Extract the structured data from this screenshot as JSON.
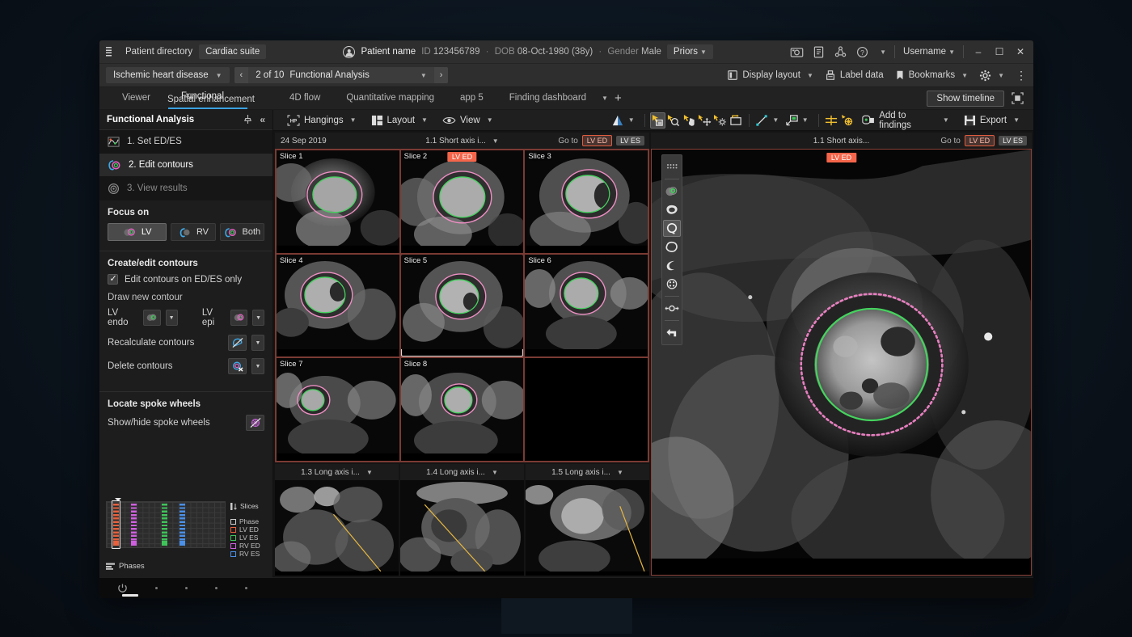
{
  "header": {
    "patient_directory": "Patient directory",
    "cardiac_suite": "Cardiac suite",
    "patient_name": "Patient name",
    "id_label": "ID",
    "id_value": "123456789",
    "dob_label": "DOB",
    "dob_value": "08-Oct-1980 (38y)",
    "gender_label": "Gender",
    "gender_value": "Male",
    "priors": "Priors",
    "username": "Username",
    "icons": [
      "camera-icon",
      "report-icon",
      "share-icon",
      "help-icon"
    ],
    "window_controls": [
      "minimize",
      "maximize",
      "close"
    ]
  },
  "bar2": {
    "disease": "Ischemic heart disease",
    "prev": "‹",
    "next": "›",
    "counter": "2 of 10",
    "study": "Functional Analysis",
    "display_layout": "Display layout",
    "label_data": "Label data",
    "bookmarks": "Bookmarks"
  },
  "tabs": {
    "items": [
      {
        "label": "Viewer",
        "active": false
      },
      {
        "label": "4D flow",
        "active": false
      },
      {
        "label": "Quantitative mapping",
        "active": false
      },
      {
        "label": "app 5",
        "active": false
      },
      {
        "label": "Finding dashboard",
        "active": false
      }
    ],
    "overlap_front": "Functional",
    "overlap_front_close": "×",
    "overlap_back": "Spatial enhancement",
    "add": "+",
    "show_timeline": "Show timeline"
  },
  "sidebar": {
    "title": "Functional Analysis",
    "steps": [
      {
        "label": "1. Set ED/ES",
        "state": "normal",
        "icon": "ed-es-curve-icon"
      },
      {
        "label": "2. Edit contours",
        "state": "active",
        "icon": "contours-icon"
      },
      {
        "label": "3. View results",
        "state": "disabled",
        "icon": "results-icon"
      }
    ],
    "focus_on_label": "Focus on",
    "focus_options": [
      {
        "label": "LV",
        "selected": true
      },
      {
        "label": "RV",
        "selected": false
      },
      {
        "label": "Both",
        "selected": false
      }
    ],
    "create_edit_label": "Create/edit contours",
    "edit_only_label": "Edit contours on ED/ES only",
    "edit_only_checked": true,
    "draw_new_label": "Draw new contour",
    "lv_endo_label": "LV endo",
    "lv_epi_label": "LV epi",
    "recalculate_label": "Recalculate contours",
    "delete_label": "Delete contours",
    "locate_label": "Locate spoke wheels",
    "show_hide_label": "Show/hide spoke wheels"
  },
  "phases_widget": {
    "slices_label": "Slices",
    "phases_label": "Phases",
    "legend": [
      {
        "label": "Phase",
        "color": "#d0d0d0"
      },
      {
        "label": "LV ED",
        "color": "#e8603c"
      },
      {
        "label": "LV ES",
        "color": "#3fc45a"
      },
      {
        "label": "RV ED",
        "color": "#d05fe0"
      },
      {
        "label": "RV ES",
        "color": "#4a8fe8"
      }
    ],
    "columns": [
      {
        "color": "#e8603c",
        "x": 8,
        "selected": true
      },
      {
        "color": "#d05fe0",
        "x": 30,
        "selected": false
      },
      {
        "color": "#3fc45a",
        "x": 68,
        "selected": false
      },
      {
        "color": "#4a8fe8",
        "x": 90,
        "selected": false
      }
    ]
  },
  "toolbar": {
    "hangings": "Hangings",
    "layout": "Layout",
    "view": "View",
    "add_to_findings": "Add to findings",
    "export": "Export",
    "tools": [
      {
        "name": "window-level-icon",
        "active": false
      },
      {
        "name": "pan-select-icon",
        "active": true
      },
      {
        "name": "zoom-icon",
        "active": false
      },
      {
        "name": "pan-hand-icon",
        "active": false
      },
      {
        "name": "move-icon",
        "active": false
      },
      {
        "name": "contrast-icon",
        "active": false
      },
      {
        "name": "reset-icon",
        "active": false
      },
      {
        "name": "measure-line-icon",
        "active": false
      },
      {
        "name": "annotate-icon",
        "active": false
      },
      {
        "name": "crosshair-icon",
        "active": false
      },
      {
        "name": "spoke-wheel-icon",
        "active": false
      }
    ]
  },
  "left_pane": {
    "date": "24 Sep 2019",
    "title": "1.1 Short axis i...",
    "goto": "Go to",
    "badge_ed": "LV ED",
    "badge_es": "LV ES",
    "slices": [
      {
        "label": "Slice 1",
        "badge": null,
        "selected": false
      },
      {
        "label": "Slice 2",
        "badge": "LV ED",
        "selected": false
      },
      {
        "label": "Slice 3",
        "badge": null,
        "selected": false
      },
      {
        "label": "Slice 4",
        "badge": null,
        "selected": false
      },
      {
        "label": "Slice 5",
        "badge": null,
        "selected": true
      },
      {
        "label": "Slice 6",
        "badge": null,
        "selected": false
      },
      {
        "label": "Slice 7",
        "badge": null,
        "selected": false
      },
      {
        "label": "Slice 8",
        "badge": null,
        "selected": false
      },
      {
        "label": "",
        "badge": null,
        "selected": false
      }
    ],
    "long_axis": [
      {
        "title": "1.3 Long axis i..."
      },
      {
        "title": "1.4 Long axis i..."
      },
      {
        "title": "1.5 Long axis i..."
      }
    ]
  },
  "right_pane": {
    "title": "1.1 Short axis...",
    "goto": "Go to",
    "badge_ed": "LV ED",
    "badge_es": "LV ES",
    "overlay_badge": "LV ED",
    "palette_tools": [
      {
        "name": "grip-handle-icon",
        "active": false
      },
      {
        "name": "endo-contour-icon",
        "active": false
      },
      {
        "name": "freehand-contour-icon",
        "active": false
      },
      {
        "name": "circle-contour-icon",
        "active": true
      },
      {
        "name": "blob-contour-icon",
        "active": false
      },
      {
        "name": "crescent-contour-icon",
        "active": false
      },
      {
        "name": "spoke-wheel-icon",
        "active": false
      },
      {
        "name": "nudge-icon",
        "active": false
      },
      {
        "name": "undo-icon",
        "active": false
      }
    ]
  },
  "colors": {
    "epi_contour": "#ef8fc4",
    "endo_contour": "#45d35e",
    "accent_blue": "#3ba2e0",
    "badge_red": "#f4654a",
    "pane_border": "#8a4038"
  }
}
